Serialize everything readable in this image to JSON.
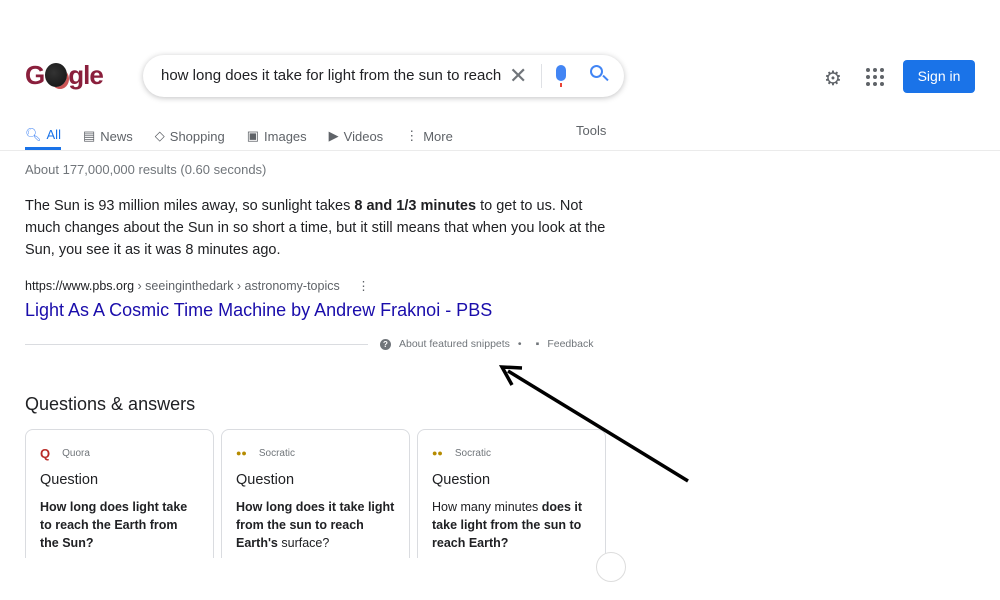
{
  "logo": {
    "text_left": "G",
    "text_right": "gle"
  },
  "search": {
    "query": "how long does it take for light from the sun to reach e"
  },
  "header": {
    "sign_in": "Sign in"
  },
  "tabs": [
    {
      "label": "All",
      "icon": "search-icon",
      "active": true
    },
    {
      "label": "News",
      "icon": "news-icon"
    },
    {
      "label": "Shopping",
      "icon": "tag-icon"
    },
    {
      "label": "Images",
      "icon": "image-icon"
    },
    {
      "label": "Videos",
      "icon": "play-icon"
    },
    {
      "label": "More",
      "icon": "more-vert-icon"
    }
  ],
  "tools": "Tools",
  "stats": "About 177,000,000 results (0.60 seconds)",
  "snippet": {
    "pre": "The Sun is 93 million miles away, so sunlight takes ",
    "bold": "8 and 1/3 minutes",
    "post": " to get to us. Not much changes about the Sun in so short a time, but it still means that when you look at the Sun, you see it as it was 8 minutes ago.",
    "cite_domain": "https://www.pbs.org",
    "cite_path": " › seeinginthedark › astronomy-topics",
    "title": "Light As A Cosmic Time Machine by Andrew Fraknoi - PBS",
    "about": "About featured snippets",
    "feedback": "Feedback",
    "dot": "•"
  },
  "qa": {
    "heading": "Questions & answers",
    "cards": [
      {
        "source": "Quora",
        "label": "Question",
        "parts": [
          {
            "b": "How long does light take to reach the Earth from the Sun?"
          }
        ]
      },
      {
        "source": "Socratic",
        "label": "Question",
        "parts": [
          {
            "b": "How long does it take light from the sun to reach Earth's"
          },
          {
            "t": " surface?"
          }
        ]
      },
      {
        "source": "Socratic",
        "label": "Question",
        "parts": [
          {
            "t": "How many minutes "
          },
          {
            "b": "does it take light from the sun to reach Earth?"
          }
        ]
      }
    ]
  },
  "colors": {
    "accent": "#1a73e8",
    "link": "#1a0dab",
    "annotation_arrow": "#000000"
  }
}
